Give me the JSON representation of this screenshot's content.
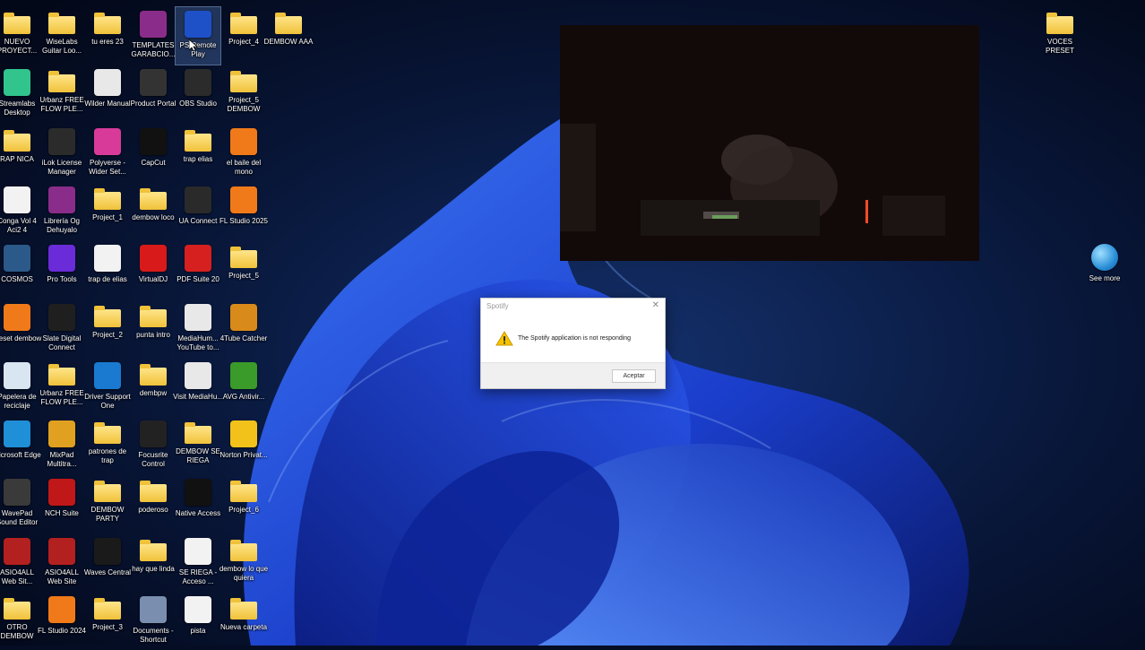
{
  "desktop": {
    "columns": [
      [
        {
          "label": "NUEVO PROYECT...",
          "icon": "folder-icon"
        },
        {
          "label": "Streamlabs Desktop",
          "icon": "streamlabs-icon"
        },
        {
          "label": "RAP NICA",
          "icon": "folder-icon"
        },
        {
          "label": "Conga Vol 4 Aci2 4",
          "icon": "media-file-icon"
        },
        {
          "label": "COSMOS",
          "icon": "cosmos-icon"
        },
        {
          "label": "preset dembow",
          "icon": "fl-studio-icon"
        },
        {
          "label": "Papelera de reciclaje",
          "icon": "recycle-bin-icon"
        },
        {
          "label": "Microsoft Edge",
          "icon": "edge-icon"
        },
        {
          "label": "WavePad Sound Editor",
          "icon": "wavepad-icon"
        },
        {
          "label": "ASIO4ALL Web Sit...",
          "icon": "asio-icon"
        },
        {
          "label": "OTRO DEMBOW",
          "icon": "folder-icon"
        }
      ],
      [
        {
          "label": "WiseLabs Guitar Loo...",
          "icon": "folder-icon"
        },
        {
          "label": "Urbanz FREE FLOW PLE...",
          "icon": "folder-icon"
        },
        {
          "label": "iLok License Manager",
          "icon": "ilok-icon"
        },
        {
          "label": "Librería Og Dehuyalo",
          "icon": "winrar-icon"
        },
        {
          "label": "Pro Tools",
          "icon": "pro-tools-icon"
        },
        {
          "label": "Slate Digital Connect",
          "icon": "slate-icon"
        },
        {
          "label": "Urbanz FREE FLOW PLE...",
          "icon": "folder-icon"
        },
        {
          "label": "MixPad Multitra...",
          "icon": "mixpad-icon"
        },
        {
          "label": "NCH Suite",
          "icon": "nch-icon"
        },
        {
          "label": "ASIO4ALL Web Site",
          "icon": "asio-icon"
        },
        {
          "label": "FL Studio 2024",
          "icon": "fl-studio-icon"
        }
      ],
      [
        {
          "label": "tu eres 23",
          "icon": "folder-icon"
        },
        {
          "label": "Wilder Manual",
          "icon": "pdf-file-icon"
        },
        {
          "label": "Polyverse - Wider Set...",
          "icon": "polyverse-icon"
        },
        {
          "label": "Project_1",
          "icon": "folder-icon"
        },
        {
          "label": "trap de elias",
          "icon": "media-file-icon"
        },
        {
          "label": "Project_2",
          "icon": "folder-icon"
        },
        {
          "label": "Driver Support One",
          "icon": "driver-support-icon"
        },
        {
          "label": "patrones de trap",
          "icon": "folder-icon"
        },
        {
          "label": "DEMBOW PARTY",
          "icon": "folder-icon"
        },
        {
          "label": "Waves Central",
          "icon": "waves-icon"
        },
        {
          "label": "Project_3",
          "icon": "folder-icon"
        }
      ],
      [
        {
          "label": "TEMPLATES GARABCIO...",
          "icon": "winrar-icon"
        },
        {
          "label": "Product Portal",
          "icon": "product-portal-icon"
        },
        {
          "label": "CapCut",
          "icon": "capcut-icon"
        },
        {
          "label": "dembow loco",
          "icon": "folder-icon"
        },
        {
          "label": "VirtualDJ",
          "icon": "virtualdj-icon"
        },
        {
          "label": "punta intro",
          "icon": "folder-icon"
        },
        {
          "label": "dembpw",
          "icon": "folder-icon"
        },
        {
          "label": "Focusrite Control",
          "icon": "focusrite-icon"
        },
        {
          "label": "poderoso",
          "icon": "folder-icon"
        },
        {
          "label": "hay que linda",
          "icon": "folder-icon"
        },
        {
          "label": "Documents - Shortcut",
          "icon": "documents-icon"
        }
      ],
      [
        {
          "label": "PS Remote Play",
          "icon": "ps-remote-play-icon",
          "selected": true
        },
        {
          "label": "OBS Studio",
          "icon": "obs-icon"
        },
        {
          "label": "trap elias",
          "icon": "folder-icon"
        },
        {
          "label": "UA Connect",
          "icon": "ua-connect-icon"
        },
        {
          "label": "PDF Suite 20",
          "icon": "pdf-suite-icon"
        },
        {
          "label": "MediaHum... YouTube to...",
          "icon": "mediahuman-icon"
        },
        {
          "label": "Visit MediaHu...",
          "icon": "mediahuman-icon"
        },
        {
          "label": "DEMBOW SE RIEGA",
          "icon": "folder-icon"
        },
        {
          "label": "Native Access",
          "icon": "native-access-icon"
        },
        {
          "label": "SE RIEGA - Acceso ...",
          "icon": "media-file-icon"
        },
        {
          "label": "pista",
          "icon": "media-file-icon"
        }
      ],
      [
        {
          "label": "Project_4",
          "icon": "folder-icon"
        },
        {
          "label": "Project_5 DEMBOW",
          "icon": "folder-icon"
        },
        {
          "label": "el baile del mono",
          "icon": "fl-studio-icon"
        },
        {
          "label": "FL Studio 2025",
          "icon": "fl-studio-icon"
        },
        {
          "label": "Project_5",
          "icon": "folder-icon"
        },
        {
          "label": "4Tube Catcher",
          "icon": "tube-catcher-icon"
        },
        {
          "label": "AVG Antivir...",
          "icon": "avg-icon"
        },
        {
          "label": "Norton Privat...",
          "icon": "norton-icon"
        },
        {
          "label": "Project_6",
          "icon": "folder-icon"
        },
        {
          "label": "dembow lo que quiera",
          "icon": "folder-icon"
        },
        {
          "label": "Nueva carpeta",
          "icon": "folder-icon"
        }
      ],
      [
        {
          "label": "DEMBOW AAA",
          "icon": "folder-icon"
        }
      ]
    ],
    "right_icons": [
      {
        "label": "VOCES PRESET",
        "icon": "folder-icon"
      },
      {
        "label": "See more",
        "icon": "globe-icon"
      }
    ]
  },
  "dialog": {
    "title": "Spotify",
    "message": "The Spotify application is not responding",
    "button": "Aceptar",
    "close_glyph": "✕"
  }
}
